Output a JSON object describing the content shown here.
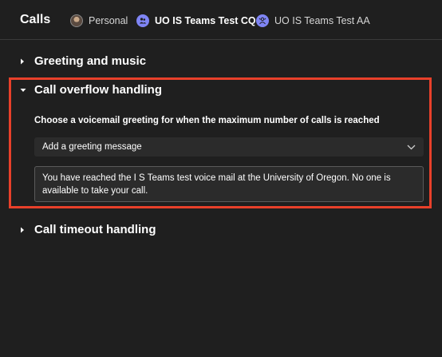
{
  "header": {
    "title": "Calls",
    "tabs": [
      {
        "label": "Personal"
      },
      {
        "label": "UO IS Teams Test CQ"
      },
      {
        "label": "UO IS Teams Test AA"
      }
    ]
  },
  "sections": {
    "greeting": {
      "title": "Greeting and music"
    },
    "overflow": {
      "title": "Call overflow handling",
      "label": "Choose a voicemail greeting for when the maximum number of calls is reached",
      "dropdown_value": "Add a greeting message",
      "message": "You have reached the I S Teams test voice mail at the University of Oregon. No one is available to take your call."
    },
    "timeout": {
      "title": "Call timeout handling"
    }
  },
  "colors": {
    "background": "#1f1f1f",
    "highlight": "#e8402a",
    "team_avatar": "#7f85f5"
  }
}
